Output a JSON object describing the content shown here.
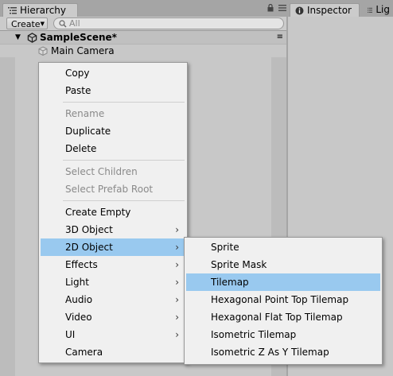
{
  "hierarchy": {
    "tab_label": "Hierarchy",
    "create_label": "Create",
    "search_placeholder": "All",
    "scene_name": "SampleScene*",
    "objects": [
      "Main Camera"
    ]
  },
  "inspector": {
    "tab_label": "Inspector",
    "second_tab_label": "Lig"
  },
  "context_menu": {
    "items": [
      {
        "label": "Copy",
        "enabled": true
      },
      {
        "label": "Paste",
        "enabled": true
      },
      {
        "label": "Rename",
        "enabled": false
      },
      {
        "label": "Duplicate",
        "enabled": true
      },
      {
        "label": "Delete",
        "enabled": true
      },
      {
        "label": "Select Children",
        "enabled": false
      },
      {
        "label": "Select Prefab Root",
        "enabled": false
      },
      {
        "label": "Create Empty",
        "enabled": true
      },
      {
        "label": "3D Object",
        "enabled": true,
        "submenu": true
      },
      {
        "label": "2D Object",
        "enabled": true,
        "submenu": true,
        "highlighted": true
      },
      {
        "label": "Effects",
        "enabled": true,
        "submenu": true
      },
      {
        "label": "Light",
        "enabled": true,
        "submenu": true
      },
      {
        "label": "Audio",
        "enabled": true,
        "submenu": true
      },
      {
        "label": "Video",
        "enabled": true,
        "submenu": true
      },
      {
        "label": "UI",
        "enabled": true,
        "submenu": true
      },
      {
        "label": "Camera",
        "enabled": true
      }
    ]
  },
  "submenu_2d": {
    "items": [
      {
        "label": "Sprite"
      },
      {
        "label": "Sprite Mask"
      },
      {
        "label": "Tilemap",
        "highlighted": true
      },
      {
        "label": "Hexagonal Point Top Tilemap"
      },
      {
        "label": "Hexagonal Flat Top Tilemap"
      },
      {
        "label": "Isometric Tilemap"
      },
      {
        "label": "Isometric Z As Y Tilemap"
      }
    ]
  },
  "colors": {
    "highlight": "#99c9ef",
    "menu_bg": "#f0f0f0",
    "disabled_text": "#8a8a8a",
    "panel_bg": "#c8c8c8"
  }
}
